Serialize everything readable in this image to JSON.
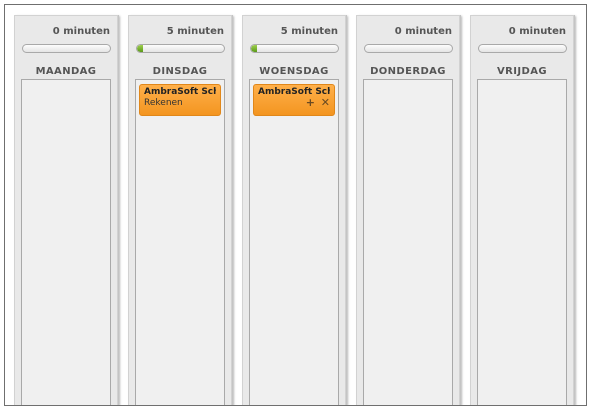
{
  "days": [
    {
      "label": "MAANDAG",
      "minutes": "0 minuten",
      "progress": 0,
      "cards": []
    },
    {
      "label": "DINSDAG",
      "minutes": "5 minuten",
      "progress": 0.07,
      "cards": [
        {
          "title": "AmbraSoft Sch...",
          "subject": "Rekenen"
        }
      ]
    },
    {
      "label": "WOENSDAG",
      "minutes": "5 minuten",
      "progress": 0.07,
      "cards": [
        {
          "title": "AmbraSoft Sch...",
          "add_icon": "+",
          "remove_icon": "✕"
        }
      ]
    },
    {
      "label": "DONDERDAG",
      "minutes": "0 minuten",
      "progress": 0,
      "cards": []
    },
    {
      "label": "VRIJDAG",
      "minutes": "0 minuten",
      "progress": 0,
      "cards": []
    }
  ],
  "icons": {
    "add": "plus-icon",
    "remove": "close-icon"
  },
  "colors": {
    "card": "#f39520",
    "progress_fill": "#6aaa22",
    "column_bg": "#e9e9e9",
    "dropzone_bg": "#f0f0f0"
  }
}
